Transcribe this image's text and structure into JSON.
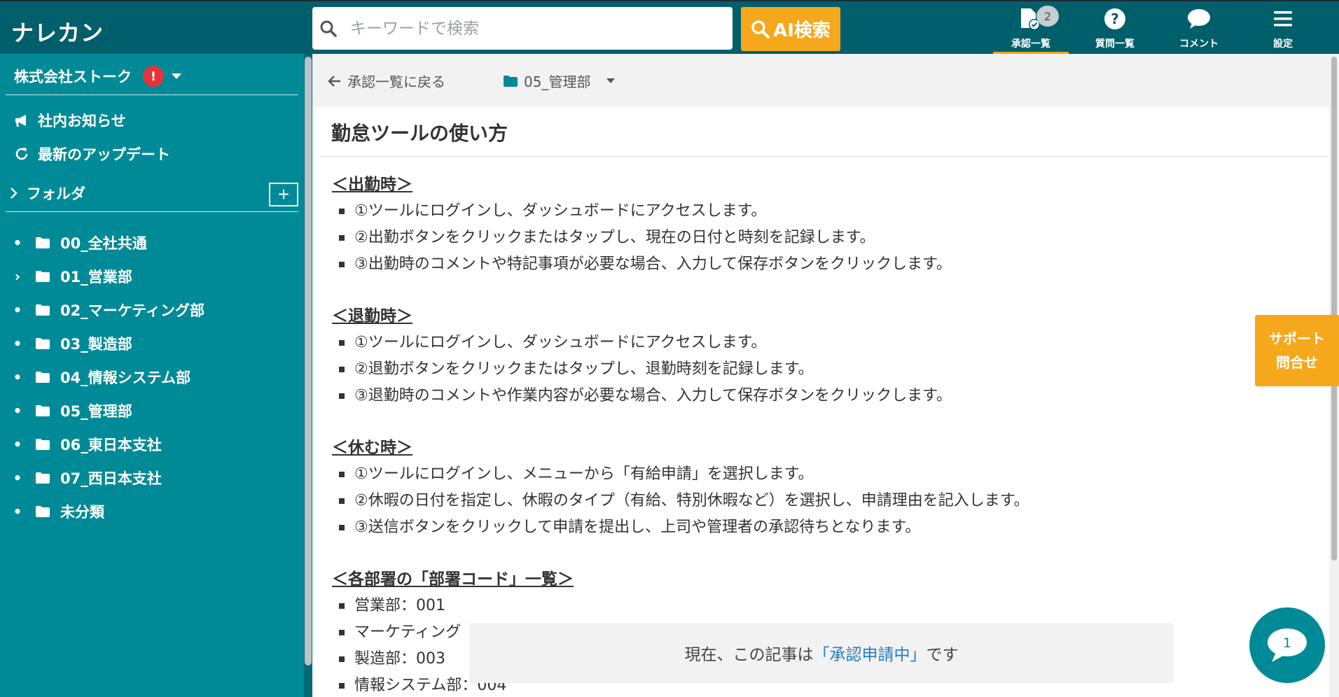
{
  "app": {
    "logo": "ナレカン"
  },
  "search": {
    "placeholder": "キーワードで検索"
  },
  "ai_search": {
    "label": "AI検索"
  },
  "nav": [
    {
      "label": "承認一覧",
      "icon": "approval-doc-icon",
      "badge": "2",
      "active": true
    },
    {
      "label": "質問一覧",
      "icon": "question-circle-icon"
    },
    {
      "label": "コメント",
      "icon": "comment-bubble-icon"
    },
    {
      "label": "設定",
      "icon": "hamburger-menu-icon"
    }
  ],
  "sidebar": {
    "company": "株式会社ストーク",
    "company_alert": "!",
    "links": [
      {
        "label": "社内お知らせ",
        "icon": "megaphone-icon"
      },
      {
        "label": "最新のアップデート",
        "icon": "refresh-icon"
      }
    ],
    "folder_header": "フォルダ",
    "add_folder": "+",
    "folders": [
      {
        "label": "00_全社共通",
        "marker": "•"
      },
      {
        "label": "01_営業部",
        "marker": "›"
      },
      {
        "label": "02_マーケティング部",
        "marker": "•"
      },
      {
        "label": "03_製造部",
        "marker": "•"
      },
      {
        "label": "04_情報システム部",
        "marker": "•"
      },
      {
        "label": "05_管理部",
        "marker": "•"
      },
      {
        "label": "06_東日本支社",
        "marker": "•"
      },
      {
        "label": "07_西日本支社",
        "marker": "•"
      },
      {
        "label": "未分類",
        "marker": "•"
      }
    ]
  },
  "toolbar": {
    "back": "承認一覧に戻る",
    "folder": "05_管理部"
  },
  "article": {
    "title": "勤怠ツールの使い方",
    "sections": [
      {
        "heading": "＜出勤時＞",
        "items": [
          "①ツールにログインし、ダッシュボードにアクセスします。",
          "②出勤ボタンをクリックまたはタップし、現在の日付と時刻を記録します。",
          "③出勤時のコメントや特記事項が必要な場合、入力して保存ボタンをクリックします。"
        ]
      },
      {
        "heading": "＜退勤時＞",
        "items": [
          "①ツールにログインし、ダッシュボードにアクセスします。",
          "②退勤ボタンをクリックまたはタップし、退勤時刻を記録します。",
          "③退勤時のコメントや作業内容が必要な場合、入力して保存ボタンをクリックします。"
        ]
      },
      {
        "heading": "＜休む時＞",
        "items": [
          "①ツールにログインし、メニューから「有給申請」を選択します。",
          "②休暇の日付を指定し、休暇のタイプ（有給、特別休暇など）を選択し、申請理由を記入します。",
          "③送信ボタンをクリックして申請を提出し、上司や管理者の承認待ちとなります。"
        ]
      },
      {
        "heading": "＜各部署の「部署コード」一覧＞",
        "items": [
          "営業部：001",
          "マーケティング",
          "製造部：003",
          "情報システム部：004"
        ]
      }
    ]
  },
  "support": {
    "line1": "サポート",
    "line2": "問合せ"
  },
  "status": {
    "prefix": "現在、この記事は",
    "highlight": "「承認申請中」",
    "suffix": "です"
  },
  "chat": {
    "count": "1"
  }
}
